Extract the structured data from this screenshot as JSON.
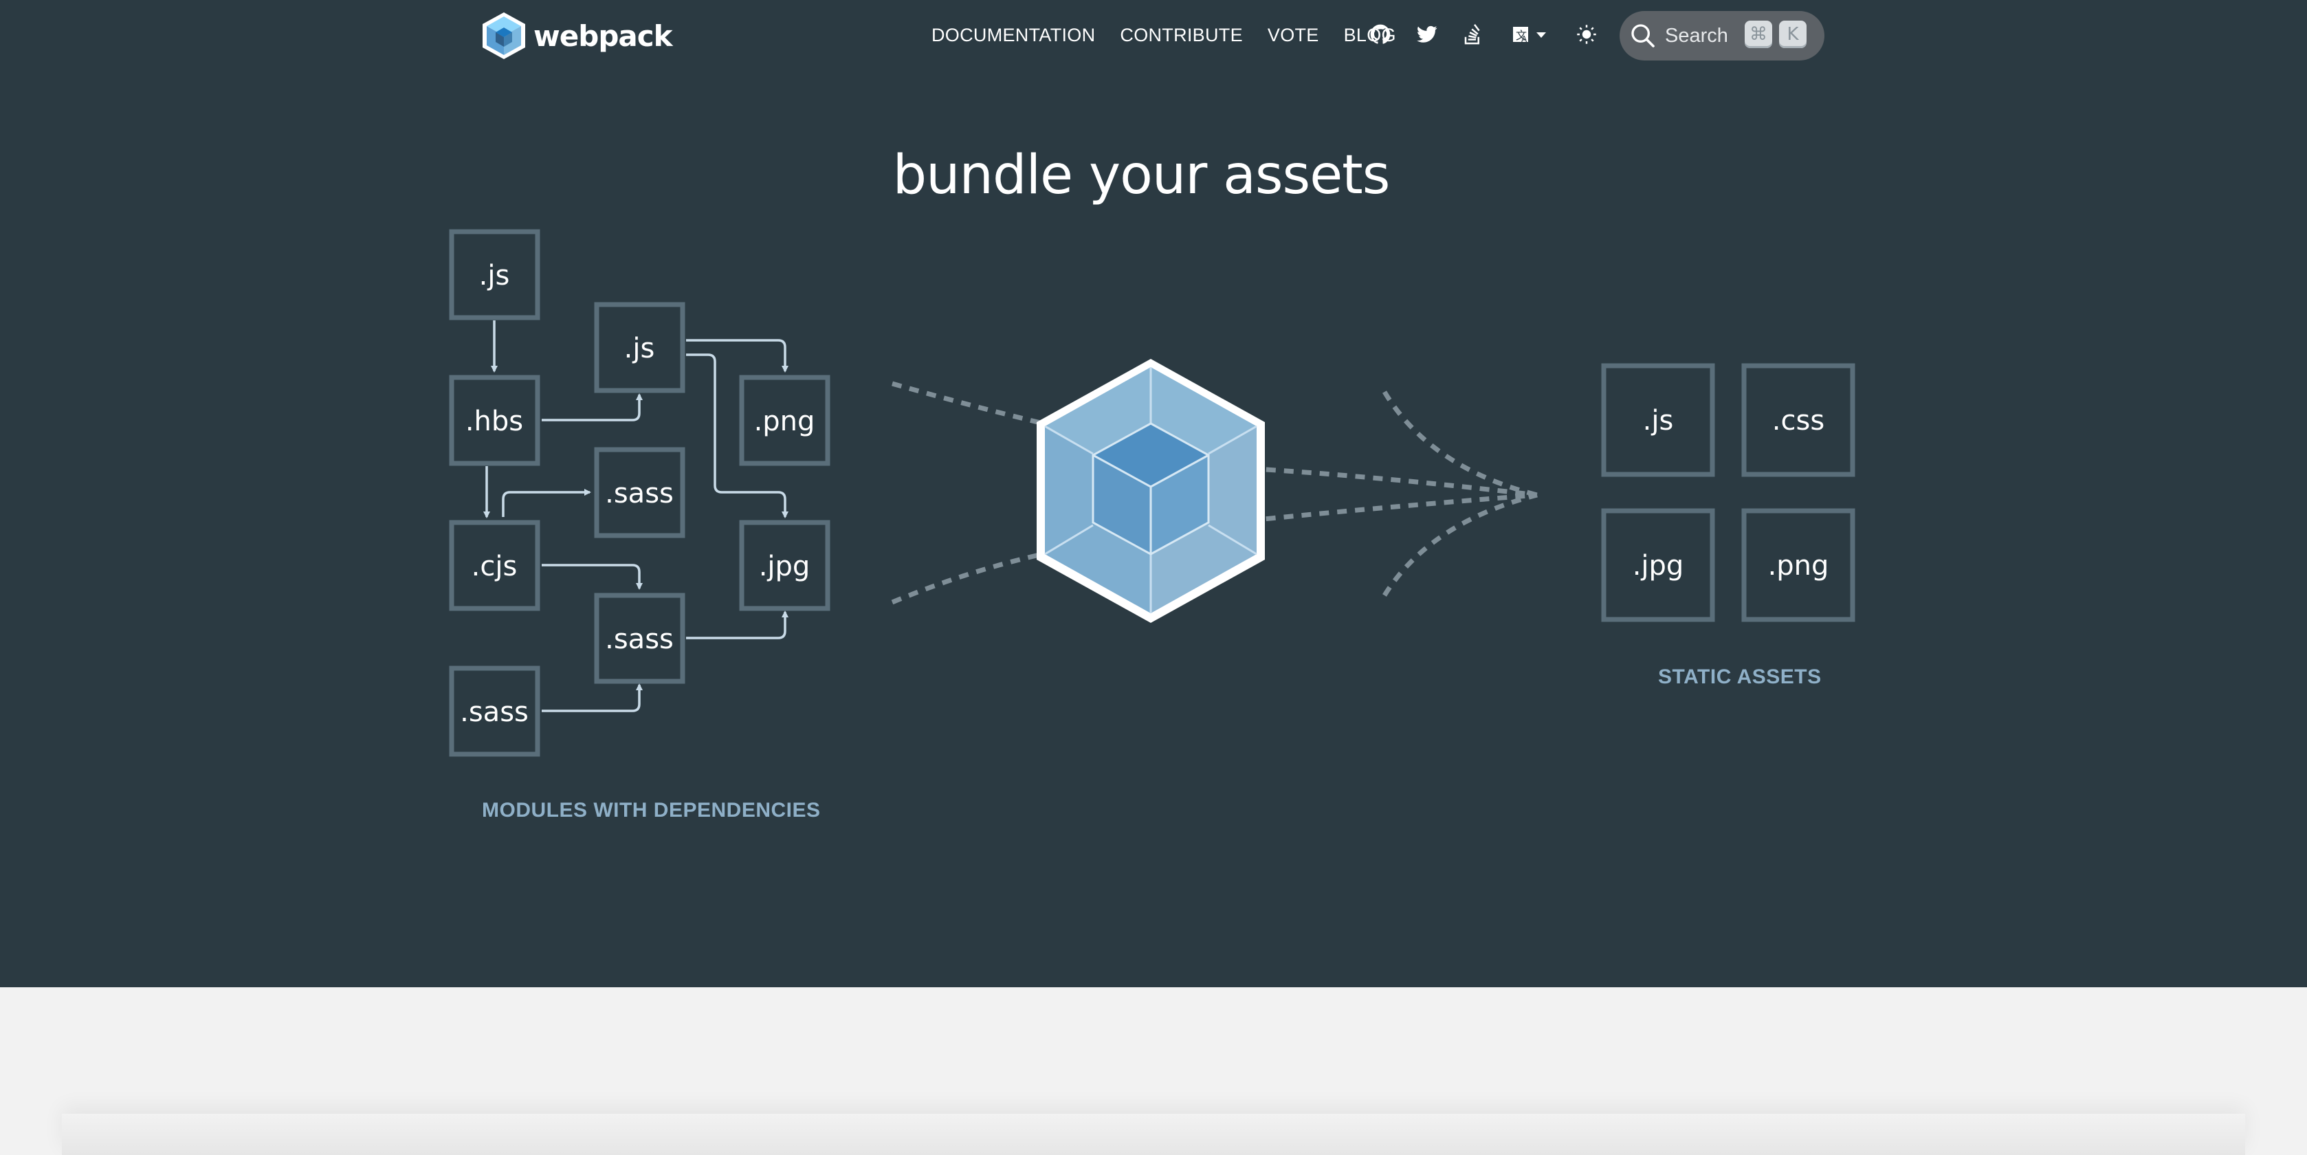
{
  "header": {
    "logo_text": "webpack",
    "nav": [
      "DOCUMENTATION",
      "CONTRIBUTE",
      "VOTE",
      "BLOG"
    ],
    "icons": [
      "github-icon",
      "twitter-icon",
      "stackoverflow-icon",
      "language-icon",
      "theme-toggle-icon"
    ],
    "search": {
      "label": "Search",
      "key1": "⌘",
      "key2": "K"
    }
  },
  "hero": {
    "title": "bundle your assets",
    "modules": [
      ".js",
      ".js",
      ".hbs",
      ".png",
      ".sass",
      ".cjs",
      ".jpg",
      ".sass",
      ".sass"
    ],
    "modules_caption": "MODULES WITH DEPENDENCIES",
    "assets": [
      ".js",
      ".css",
      ".jpg",
      ".png"
    ],
    "assets_caption": "STATIC ASSETS"
  },
  "colors": {
    "hero_bg": "#2b3a42",
    "box_border": "#5a6e7a",
    "cube_light": "#8ed6fb",
    "cube_dark": "#1c78c0",
    "caption": "#8fb0c8"
  }
}
